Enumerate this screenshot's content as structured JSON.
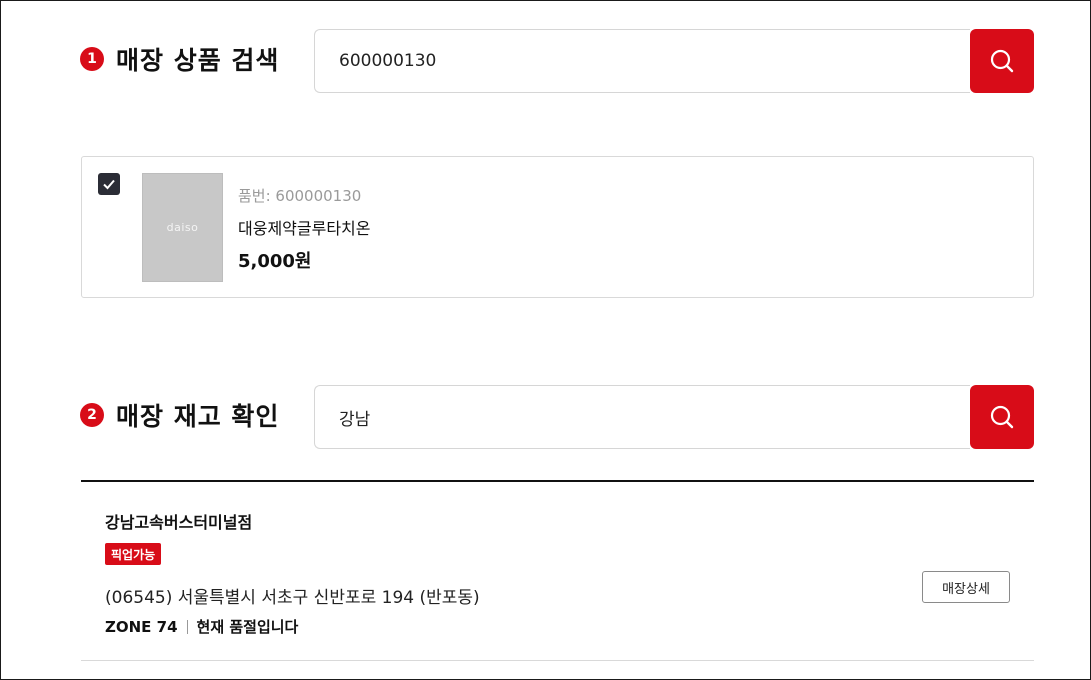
{
  "colors": {
    "accent": "#d80c18",
    "checkbox": "#2b2d36",
    "thumb": "#c8c8c8"
  },
  "product_search": {
    "step_number": "1",
    "title": "매장 상품 검색",
    "query": "600000130",
    "search_icon": "search-icon"
  },
  "product": {
    "selected": true,
    "thumb_logo": "daiso",
    "code_text": "품번: 600000130",
    "name": "대웅제약글루타치온",
    "price": "5,000원"
  },
  "stock_check": {
    "step_number": "2",
    "title": "매장 재고 확인",
    "query": "강남",
    "search_icon": "search-icon"
  },
  "stores": [
    {
      "name": "강남고속버스터미널점",
      "badge": "픽업가능",
      "address": "(06545) 서울특별시 서초구 신반포로 194 (반포동)",
      "zone": "ZONE 74",
      "stock_status": "현재 품절입니다",
      "detail_button": "매장상세"
    }
  ]
}
